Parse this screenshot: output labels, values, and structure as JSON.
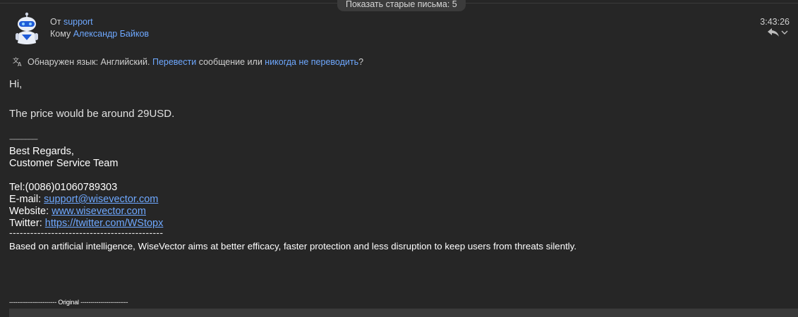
{
  "toolbar": {
    "show_older": "Показать старые письма: 5"
  },
  "header": {
    "from_prefix": "От",
    "from_name": "support",
    "to_prefix": "Кому",
    "to_name": "Александр Байков",
    "time": "3:43:26"
  },
  "translate": {
    "detected": "Обнаружен язык: Английский.",
    "translate_link": "Перевести",
    "middle": "сообщение или",
    "never_link": "никогда не переводить",
    "end": "?"
  },
  "body": {
    "greeting": "Hi,",
    "price_line": "The price would be around 29USD.",
    "short_divider": "------------------------",
    "regards": "Best Regards,",
    "team": "Customer Service Team",
    "tel": "Tel:(0086)01060789303",
    "email_label": "E-mail:",
    "email": "support@wisevector.com",
    "website_label": "Website:",
    "website": "www.wisevector.com",
    "twitter_label": "Twitter:",
    "twitter": "https://twitter.com/WStopx",
    "long_divider": "--------------------------------------------",
    "disclaimer": "Based on artificial intelligence, WiseVector aims at better efficacy, faster protection and less disruption to keep users from threats silently.",
    "original": "------------------------ Original ------------------------"
  },
  "colors": {
    "link": "#6ea8ff",
    "background": "#262626",
    "accent_avatar": "#1e5bd8"
  }
}
